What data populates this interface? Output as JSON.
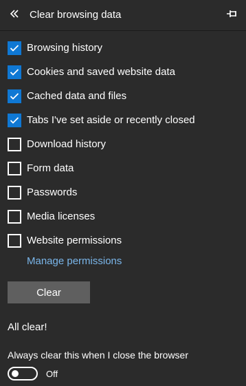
{
  "header": {
    "title": "Clear browsing data",
    "back_icon": "double-chevron-left-icon",
    "pin_icon": "pin-icon"
  },
  "options": [
    {
      "label": "Browsing history",
      "checked": true
    },
    {
      "label": "Cookies and saved website data",
      "checked": true
    },
    {
      "label": "Cached data and files",
      "checked": true
    },
    {
      "label": "Tabs I've set aside or recently closed",
      "checked": true
    },
    {
      "label": "Download history",
      "checked": false
    },
    {
      "label": "Form data",
      "checked": false
    },
    {
      "label": "Passwords",
      "checked": false
    },
    {
      "label": "Media licenses",
      "checked": false
    },
    {
      "label": "Website permissions",
      "checked": false
    }
  ],
  "manage_permissions_link": "Manage permissions",
  "clear_button": "Clear",
  "status_text": "All clear!",
  "always_clear": {
    "label": "Always clear this when I close the browser",
    "toggle_on": false,
    "state_text": "Off"
  },
  "colors": {
    "background": "#2b2b2b",
    "accent": "#0f78d4",
    "link": "#7ab6ea",
    "button": "#5f5f5f"
  }
}
